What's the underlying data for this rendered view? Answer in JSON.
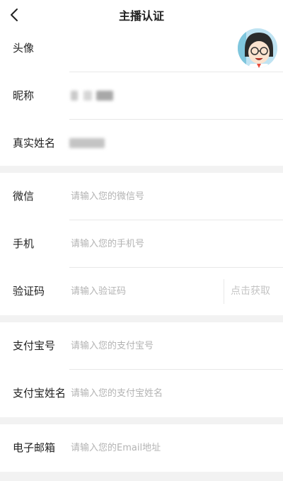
{
  "header": {
    "title": "主播认证"
  },
  "profile": {
    "avatar_label": "头像",
    "nickname_label": "昵称",
    "realname_label": "真实姓名"
  },
  "contact": {
    "wechat": {
      "label": "微信",
      "value": "",
      "placeholder": "请输入您的微信号"
    },
    "phone": {
      "label": "手机",
      "value": "",
      "placeholder": "请输入您的手机号"
    },
    "code": {
      "label": "验证码",
      "value": "",
      "placeholder": "请输入验证码",
      "button_label": "点击获取"
    }
  },
  "alipay": {
    "account": {
      "label": "支付宝号",
      "value": "",
      "placeholder": "请输入您的支付宝号"
    },
    "name": {
      "label": "支付宝姓名",
      "value": "",
      "placeholder": "请输入您的支付宝姓名"
    }
  },
  "email": {
    "label": "电子邮箱",
    "value": "",
    "placeholder": "请输入您的Email地址"
  },
  "colors": {
    "background": "#f2f2f2",
    "card": "#ffffff",
    "divider": "#e8e8e8",
    "text": "#222222",
    "placeholder": "#b3b3b3",
    "button_disabled": "#c4c4c4"
  },
  "icons": {
    "back": "chevron-left-icon"
  }
}
